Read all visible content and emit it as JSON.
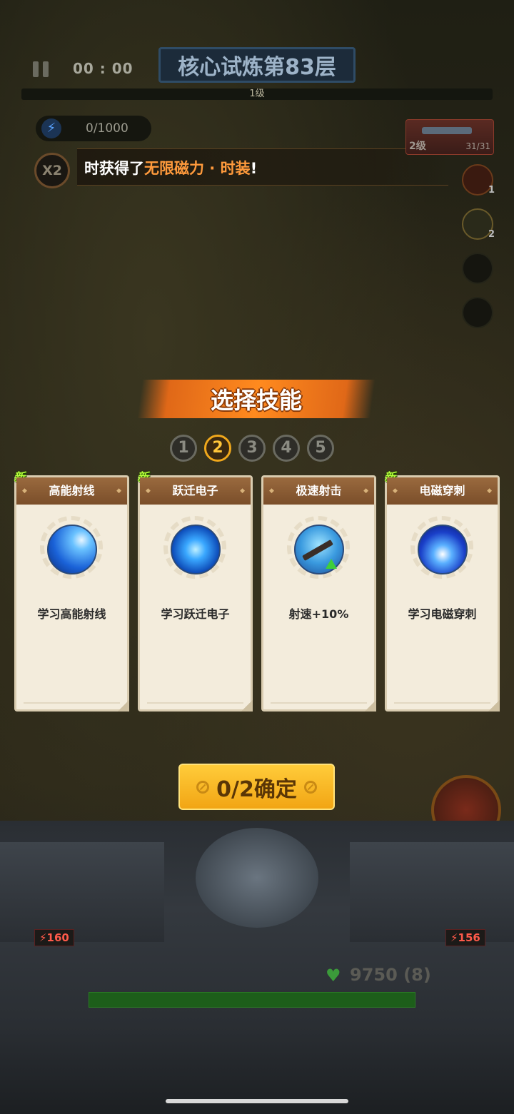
{
  "hud": {
    "timer": "00 : 00",
    "stage_title": "核心试炼第83层",
    "level_label": "1级",
    "energy": "0/1000",
    "multiplier": "X2",
    "notice_prefix": "时获得了",
    "notice_highlight": "无限磁力 · 时装",
    "notice_suffix": "!",
    "weapon_level": "2级",
    "weapon_ammo": "31/31",
    "slot_counts": [
      "1",
      "2"
    ]
  },
  "panel": {
    "title": "选择技能",
    "steps": [
      "1",
      "2",
      "3",
      "4",
      "5"
    ],
    "active_step": 2,
    "new_tag": "新",
    "cards": [
      {
        "name": "高能射线",
        "desc": "学习高能射线",
        "is_new": true,
        "icon": "energy-beam-icon"
      },
      {
        "name": "跃迁电子",
        "desc": "学习跃迁电子",
        "is_new": true,
        "icon": "leap-electron-icon"
      },
      {
        "name": "极速射击",
        "desc": "射速+10%",
        "is_new": false,
        "icon": "rapid-fire-icon"
      },
      {
        "name": "电磁穿刺",
        "desc": "学习电磁穿刺",
        "is_new": true,
        "icon": "em-pierce-icon"
      }
    ],
    "confirm_label": "0/2确定"
  },
  "base": {
    "left_energy": "160",
    "right_energy": "156",
    "hp": "9750 (8)"
  },
  "colors": {
    "accent_orange": "#ff8a1e",
    "highlight_text": "#ff9a3c",
    "confirm_yellow": "#f2a514",
    "new_green": "#b6ff3a"
  }
}
